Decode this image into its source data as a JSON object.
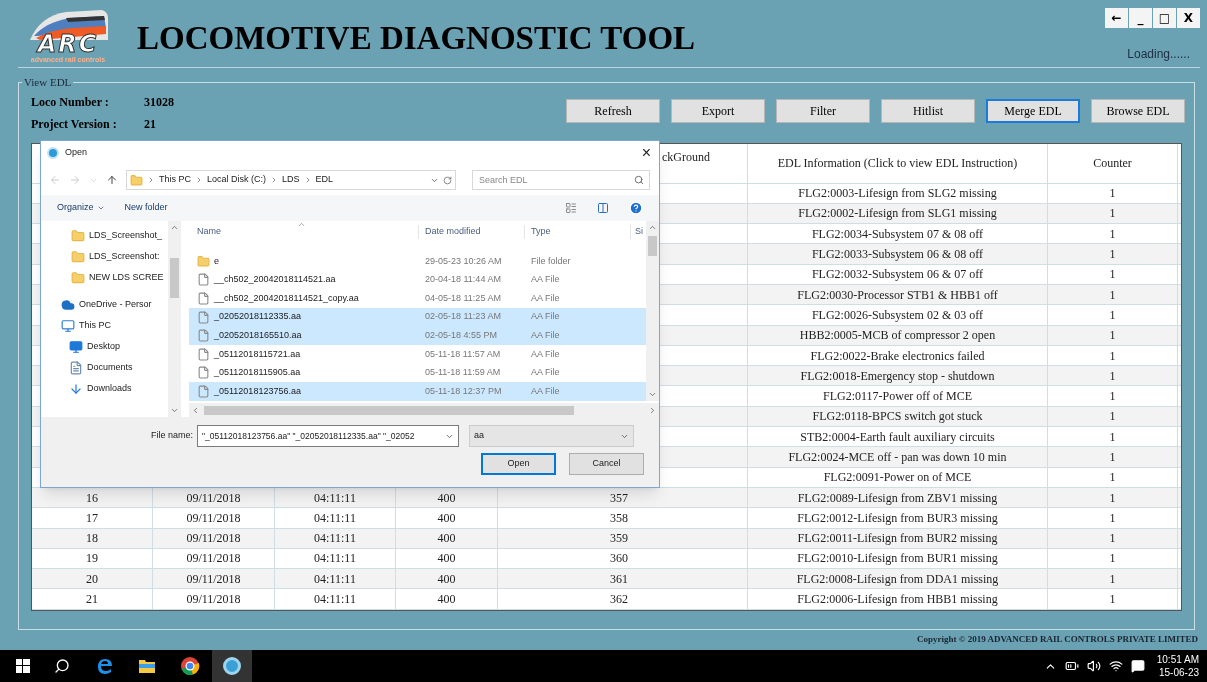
{
  "app": {
    "logo_text": "ARC",
    "logo_tagline": "advanced rail controls",
    "title": "LOCOMOTIVE DIAGNOSTIC TOOL",
    "window_controls": [
      "←",
      "_",
      "□",
      "X"
    ],
    "status": "Loading......"
  },
  "view_edl": {
    "legend": "View EDL",
    "fields": [
      {
        "label": "Loco Number :",
        "value": "31028"
      },
      {
        "label": "Project Version :",
        "value": "21"
      }
    ],
    "buttons": [
      {
        "label": "Refresh",
        "focused": false
      },
      {
        "label": "Export",
        "focused": false
      },
      {
        "label": "Filter",
        "focused": false
      },
      {
        "label": "Hitlist",
        "focused": false
      },
      {
        "label": "Merge EDL",
        "focused": true
      },
      {
        "label": "Browse EDL",
        "focused": false
      }
    ]
  },
  "table": {
    "header": {
      "column_5": "ckGround",
      "edl_information": "EDL Information (Click to view EDL Instruction)",
      "counter": "Counter"
    },
    "rows": [
      {
        "edl_information": "FLG2:0003-Lifesign from SLG2 missing",
        "counter": "1"
      },
      {
        "edl_information": "FLG2:0002-Lifesign from SLG1 missing",
        "counter": "1"
      },
      {
        "edl_information": "FLG2:0034-Subsystem 07 & 08 off",
        "counter": "1"
      },
      {
        "edl_information": "FLG2:0033-Subsystem 06 & 08 off",
        "counter": "1"
      },
      {
        "edl_information": "FLG2:0032-Subsystem 06 & 07 off",
        "counter": "1"
      },
      {
        "edl_information": "FLG2:0030-Processor STB1 & HBB1 off",
        "counter": "1"
      },
      {
        "edl_information": "FLG2:0026-Subsystem 02 & 03 off",
        "counter": "1"
      },
      {
        "edl_information": "HBB2:0005-MCB of compressor 2 open",
        "counter": "1"
      },
      {
        "edl_information": "FLG2:0022-Brake electronics failed",
        "counter": "1"
      },
      {
        "edl_information": "FLG2:0018-Emergency stop - shutdown",
        "counter": "1"
      },
      {
        "edl_information": "FLG2:0117-Power off of MCE",
        "counter": "1"
      },
      {
        "edl_information": "FLG2:0118-BPCS switch got stuck",
        "counter": "1"
      },
      {
        "edl_information": "STB2:0004-Earth fault auxiliary circuits",
        "counter": "1"
      },
      {
        "edl_information": "FLG2:0024-MCE off - pan was down 10 min",
        "counter": "1"
      },
      {
        "edl_information": "FLG2:0091-Power on of MCE",
        "counter": "1"
      },
      {
        "column_1": "16",
        "column_2": "09/11/2018",
        "column_3": "04:11:11",
        "column_4": "400",
        "column_5": "357",
        "edl_information": "FLG2:0089-Lifesign from ZBV1 missing",
        "counter": "1"
      },
      {
        "column_1": "17",
        "column_2": "09/11/2018",
        "column_3": "04:11:11",
        "column_4": "400",
        "column_5": "358",
        "edl_information": "FLG2:0012-Lifesign from BUR3 missing",
        "counter": "1"
      },
      {
        "column_1": "18",
        "column_2": "09/11/2018",
        "column_3": "04:11:11",
        "column_4": "400",
        "column_5": "359",
        "edl_information": "FLG2:0011-Lifesign from BUR2 missing",
        "counter": "1"
      },
      {
        "column_1": "19",
        "column_2": "09/11/2018",
        "column_3": "04:11:11",
        "column_4": "400",
        "column_5": "360",
        "edl_information": "FLG2:0010-Lifesign from BUR1 missing",
        "counter": "1"
      },
      {
        "column_1": "20",
        "column_2": "09/11/2018",
        "column_3": "04:11:11",
        "column_4": "400",
        "column_5": "361",
        "edl_information": "FLG2:0008-Lifesign from DDA1 missing",
        "counter": "1"
      },
      {
        "column_1": "21",
        "column_2": "09/11/2018",
        "column_3": "04:11:11",
        "column_4": "400",
        "column_5": "362",
        "edl_information": "FLG2:0006-Lifesign from HBB1 missing",
        "counter": "1"
      }
    ]
  },
  "copyright": "Copyright © 2019 ADVANCED RAIL CONTROLS PRIVATE LIMITED",
  "dialog": {
    "title": "Open",
    "close": "×",
    "breadcrumb": [
      "This PC",
      "Local Disk (C:)",
      "LDS",
      "EDL"
    ],
    "search_placeholder": "Search EDL",
    "toolbar": [
      "Organize",
      "New folder"
    ],
    "nav": [
      {
        "label": "LDS_Screenshot_",
        "kind": "folder"
      },
      {
        "label": "LDS_Screenshot:",
        "kind": "folder"
      },
      {
        "label": "NEW LDS SCREE",
        "kind": "folder"
      },
      {
        "label": "OneDrive - Persor",
        "kind": "cloud"
      },
      {
        "label": "This PC",
        "kind": "pc"
      },
      {
        "label": "Desktop",
        "kind": "desktop"
      },
      {
        "label": "Documents",
        "kind": "documents"
      },
      {
        "label": "Downloads",
        "kind": "downloads"
      }
    ],
    "columns": [
      "Name",
      "Date modified",
      "Type",
      "Si"
    ],
    "files": [
      {
        "name": "e",
        "date": "29-05-23 10:26 AM",
        "type": "File folder",
        "kind": "folder",
        "selected": false
      },
      {
        "name": "__ch502_20042018114521.aa",
        "date": "20-04-18 11:44 AM",
        "type": "AA File",
        "kind": "file",
        "selected": false
      },
      {
        "name": "__ch502_20042018114521_copy.aa",
        "date": "04-05-18 11:25 AM",
        "type": "AA File",
        "kind": "file",
        "selected": false
      },
      {
        "name": "_02052018112335.aa",
        "date": "02-05-18 11:23 AM",
        "type": "AA File",
        "kind": "file",
        "selected": true
      },
      {
        "name": "_02052018165510.aa",
        "date": "02-05-18 4:55 PM",
        "type": "AA File",
        "kind": "file",
        "selected": true
      },
      {
        "name": "_05112018115721.aa",
        "date": "05-11-18 11:57 AM",
        "type": "AA File",
        "kind": "file",
        "selected": false
      },
      {
        "name": "_05112018115905.aa",
        "date": "05-11-18 11:59 AM",
        "type": "AA File",
        "kind": "file",
        "selected": false
      },
      {
        "name": "_05112018123756.aa",
        "date": "05-11-18 12:37 PM",
        "type": "AA File",
        "kind": "file",
        "selected": true
      }
    ],
    "file_name_label": "File name:",
    "file_name_value": "\"_05112018123756.aa\" \"_02052018112335.aa\" \"_02052",
    "file_type": "aa",
    "buttons": [
      "Open",
      "Cancel"
    ]
  },
  "taskbar": {
    "time": "10:51 AM",
    "date": "15-06-23"
  }
}
